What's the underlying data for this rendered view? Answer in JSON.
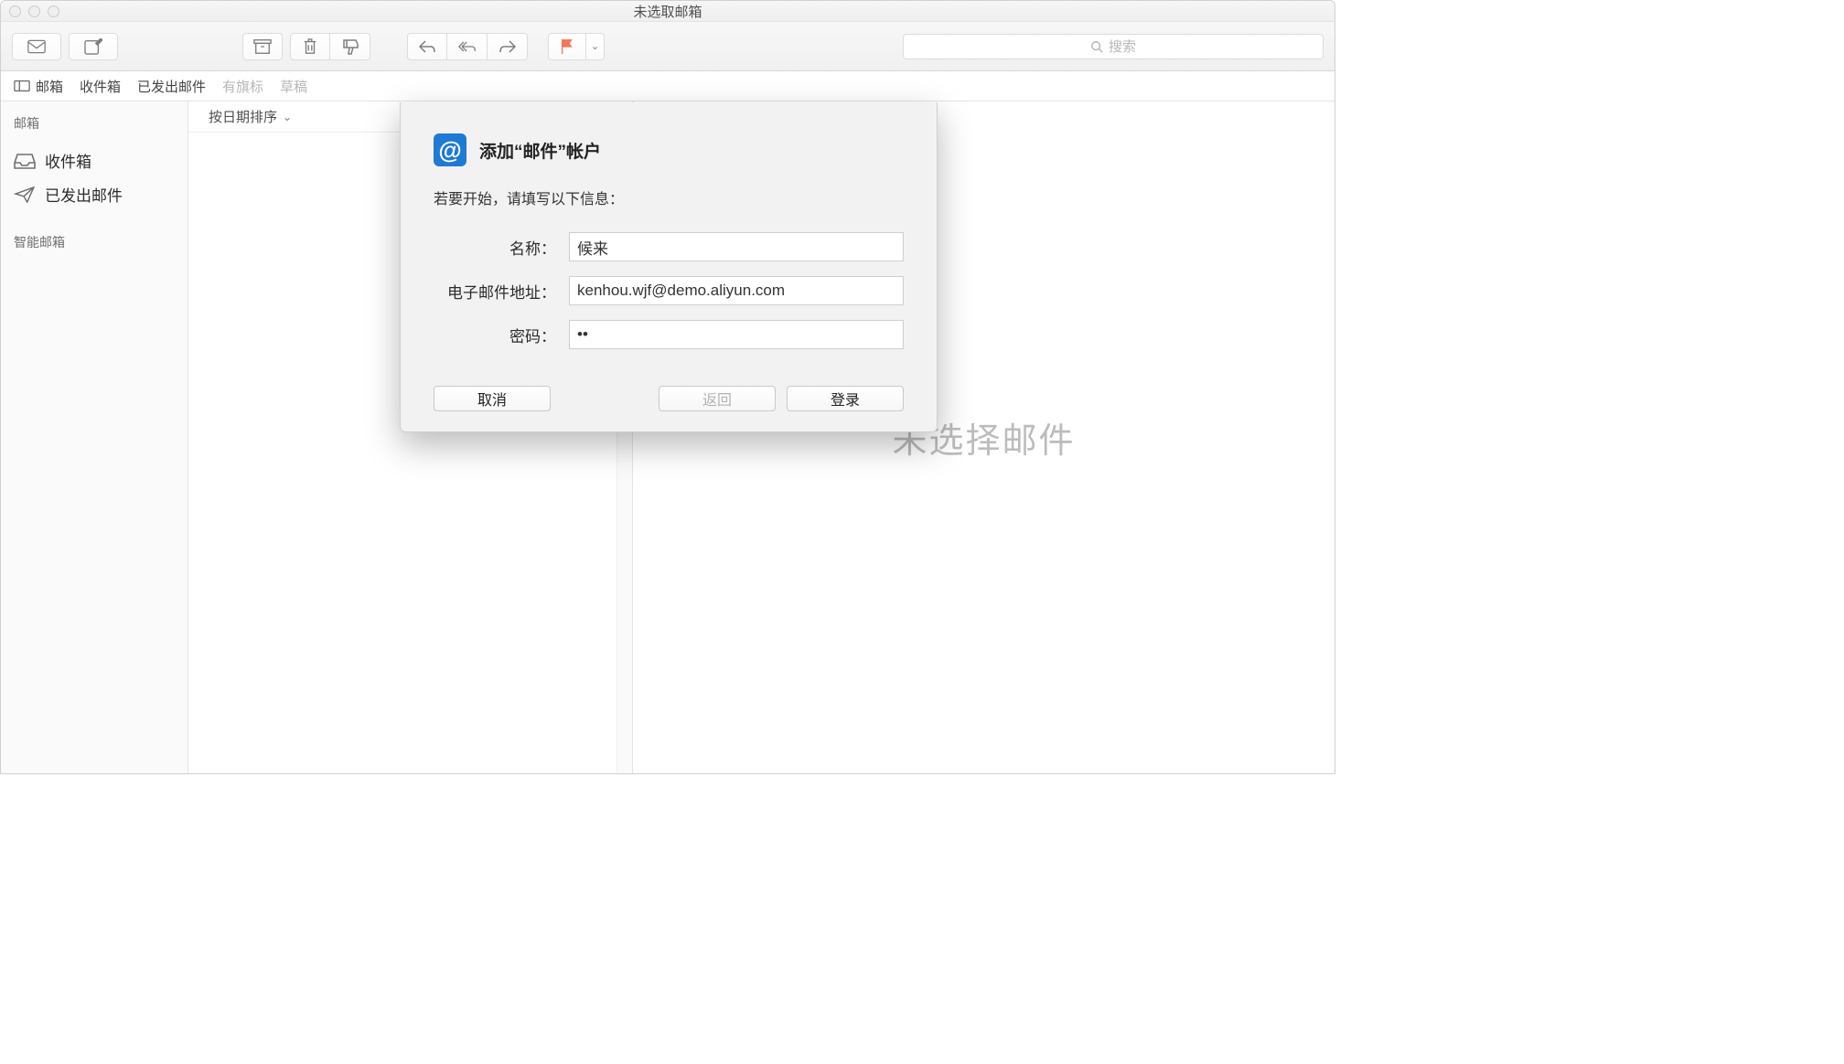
{
  "window": {
    "title": "未选取邮箱"
  },
  "toolbar": {},
  "search": {
    "placeholder": "搜索"
  },
  "favbar": {
    "mailboxes": "邮箱",
    "inbox": "收件箱",
    "sent": "已发出邮件",
    "flagged": "有旗标",
    "drafts": "草稿"
  },
  "sidebar": {
    "section_main": "邮箱",
    "items": [
      {
        "label": "收件箱",
        "icon": "inbox"
      },
      {
        "label": "已发出邮件",
        "icon": "sent"
      }
    ],
    "section_smart": "智能邮箱"
  },
  "listcol": {
    "sort_label": "按日期排序"
  },
  "preview": {
    "empty_text": "未选择邮件"
  },
  "modal": {
    "title": "添加“邮件”帐户",
    "subtitle": "若要开始，请填写以下信息：",
    "labels": {
      "name": "名称：",
      "email": "电子邮件地址：",
      "password": "密码："
    },
    "values": {
      "name": "候来",
      "email": "kenhou.wjf@demo.aliyun.com",
      "password": "••"
    },
    "buttons": {
      "cancel": "取消",
      "back": "返回",
      "login": "登录"
    }
  }
}
